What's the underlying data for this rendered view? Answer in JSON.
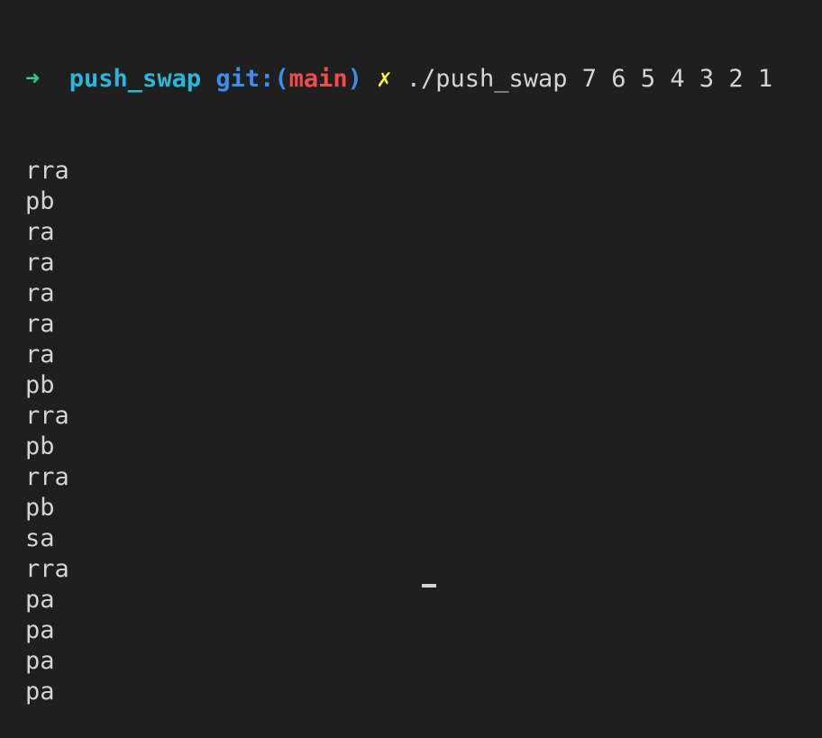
{
  "prompt": {
    "arrow": "➜",
    "directory": "push_swap",
    "git_prefix": "git:(",
    "branch": "main",
    "git_suffix": ")",
    "dirty_mark": "✗",
    "command": "./push_swap 7 6 5 4 3 2 1"
  },
  "output": [
    "rra",
    "pb",
    "ra",
    "ra",
    "ra",
    "ra",
    "ra",
    "pb",
    "rra",
    "pb",
    "rra",
    "pb",
    "sa",
    "rra",
    "pa",
    "pa",
    "pa",
    "pa"
  ],
  "colors": {
    "background": "#1f1f1f",
    "arrow": "#23d18b",
    "directory": "#29b8db",
    "git": "#3b8eea",
    "branch": "#f14c4c",
    "dirty": "#f5f543",
    "text": "#d4d4d4"
  }
}
